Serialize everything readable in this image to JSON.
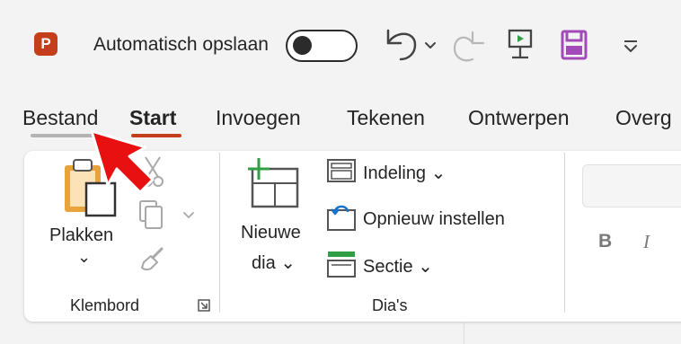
{
  "app": {
    "logo_letter": "P",
    "autosave_label": "Automatisch opslaan",
    "autosave_on": false
  },
  "tabs": [
    {
      "label": "Bestand",
      "active": false
    },
    {
      "label": "Start",
      "active": true
    },
    {
      "label": "Invoegen",
      "active": false
    },
    {
      "label": "Tekenen",
      "active": false
    },
    {
      "label": "Ontwerpen",
      "active": false
    },
    {
      "label": "Overg",
      "active": false
    }
  ],
  "ribbon": {
    "klembord": {
      "paste_label": "Plakken",
      "paste_chevron": "⌄",
      "group_label": "Klembord"
    },
    "dias": {
      "new_slide_line1": "Nieuwe",
      "new_slide_line2": "dia ⌄",
      "layout_label": "Indeling ⌄",
      "reset_label": "Opnieuw instellen",
      "section_label": "Sectie ⌄",
      "group_label": "Dia's"
    },
    "font": {
      "bold": "B",
      "italic": "I"
    }
  },
  "colors": {
    "ppt_brand": "#c43e1c",
    "save_icon": "#a24ab8",
    "start_underline": "#c43e1c",
    "bestand_underline": "#b3b3b3",
    "pointer_arrow": "#e81010",
    "new_slide_plus": "#2f9e44"
  },
  "icons": [
    "powerpoint-logo-icon",
    "undo-icon",
    "redo-icon",
    "present-from-start-icon",
    "save-icon",
    "customize-qat-icon",
    "paste-icon",
    "cut-icon",
    "copy-icon",
    "format-painter-icon",
    "dialog-launcher-icon",
    "new-slide-icon",
    "layout-icon",
    "reset-icon",
    "section-icon",
    "pointer-arrow"
  ]
}
